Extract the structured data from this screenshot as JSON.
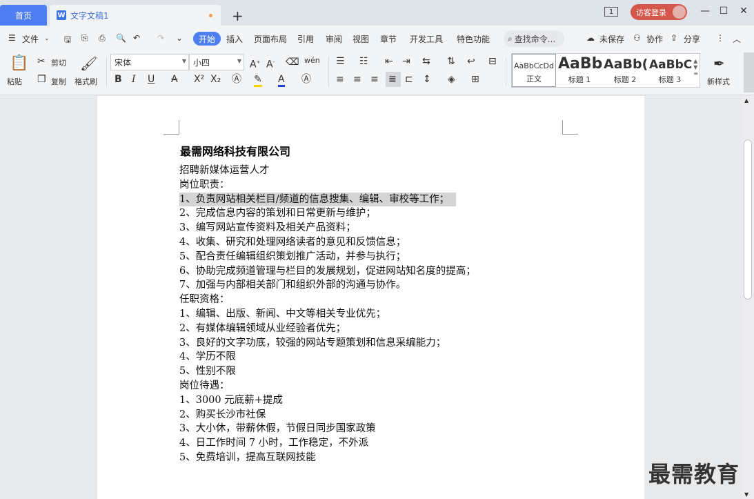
{
  "titlebar": {
    "home_tab": "首页",
    "doc_tab": "文字文稿1",
    "doc_icon_letter": "W",
    "new_tab_symbol": "+",
    "page_indicator": "1",
    "login_label": "访客登录"
  },
  "menu": {
    "file_label": "文件",
    "items": [
      "开始",
      "插入",
      "页面布局",
      "引用",
      "审阅",
      "视图",
      "章节",
      "开发工具",
      "特色功能"
    ],
    "search_placeholder": "查找命令...",
    "unsaved": "未保存",
    "collaborate": "协作",
    "share": "分享"
  },
  "toolbar": {
    "paste": "粘贴",
    "cut": "剪切",
    "copy": "复制",
    "format_painter": "格式刷",
    "font_name": "宋体",
    "font_size": "小四",
    "new_style": "新样式",
    "styles": [
      {
        "preview": "AaBbCcDd",
        "name": "正文"
      },
      {
        "preview": "AaBb",
        "name": "标题 1"
      },
      {
        "preview": "AaBb(",
        "name": "标题 2"
      },
      {
        "preview": "AaBbC",
        "name": "标题 3"
      }
    ]
  },
  "document": {
    "title": "最需网络科技有限公司",
    "lines": [
      "招聘新媒体运营人才",
      "岗位职责：",
      "1、负责网站相关栏目/频道的信息搜集、编辑、审校等工作；",
      "2、完成信息内容的策划和日常更新与维护；",
      "3、编写网站宣传资料及相关产品资料；",
      "4、收集、研究和处理网络读者的意见和反馈信息；",
      "5、配合责任编辑组织策划推广活动，并参与执行；",
      "6、协助完成频道管理与栏目的发展规划，促进网站知名度的提高；",
      "7、加强与内部相关部门和组织外部的沟通与协作。",
      "任职资格：",
      "1、编辑、出版、新闻、中文等相关专业优先；",
      "2、有媒体编辑领域从业经验者优先；",
      "3、良好的文字功底，较强的网站专题策划和信息采编能力；",
      "4、学历不限",
      "5、性别不限",
      "岗位待遇：",
      "1、3000 元底薪+提成",
      "2、购买长沙市社保",
      "3、大小休，带薪休假，节假日同步国家政策",
      "4、日工作时间 7 小时，工作稳定，不外派",
      "5、免费培训，提高互联网技能"
    ],
    "selected_line_index": 2
  },
  "watermark": "最需教育",
  "colors": {
    "accent": "#4e7ef0",
    "login_badge": "#d5574c",
    "selection": "#d4d4d4"
  }
}
